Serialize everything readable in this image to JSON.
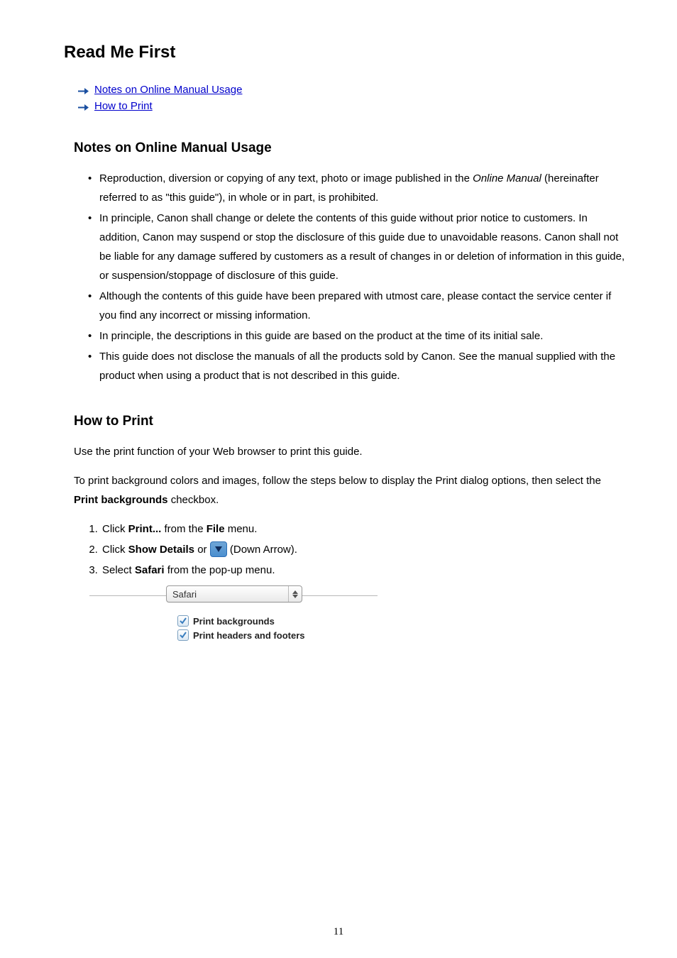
{
  "title": "Read Me First",
  "nav_links": [
    {
      "label": "Notes on Online Manual Usage"
    },
    {
      "label": "How to Print"
    }
  ],
  "section1": {
    "heading": "Notes on Online Manual Usage",
    "bullets": [
      {
        "pre": "Reproduction, diversion or copying of any text, photo or image published in the ",
        "em": "Online Manual",
        "post": " (hereinafter referred to as \"this guide\"), in whole or in part, is prohibited."
      },
      {
        "text": "In principle, Canon shall change or delete the contents of this guide without prior notice to customers. In addition, Canon may suspend or stop the disclosure of this guide due to unavoidable reasons. Canon shall not be liable for any damage suffered by customers as a result of changes in or deletion of information in this guide, or suspension/stoppage of disclosure of this guide."
      },
      {
        "text": "Although the contents of this guide have been prepared with utmost care, please contact the service center if you find any incorrect or missing information."
      },
      {
        "text": "In principle, the descriptions in this guide are based on the product at the time of its initial sale."
      },
      {
        "text": "This guide does not disclose the manuals of all the products sold by Canon. See the manual supplied with the product when using a product that is not described in this guide."
      }
    ]
  },
  "section2": {
    "heading": "How to Print",
    "para1": "Use the print function of your Web browser to print this guide.",
    "para2_pre": "To print background colors and images, follow the steps below to display the Print dialog options, then select the ",
    "para2_bold": "Print backgrounds",
    "para2_post": " checkbox.",
    "steps": {
      "s1_pre": "Click ",
      "s1_b1": "Print...",
      "s1_mid": " from the ",
      "s1_b2": "File",
      "s1_post": " menu.",
      "s2_pre": "Click ",
      "s2_b1": "Show Details",
      "s2_mid": " or ",
      "s2_post": " (Down Arrow).",
      "s3_pre": "Select ",
      "s3_b1": "Safari",
      "s3_post": " from the pop-up menu."
    }
  },
  "safari_panel": {
    "select_label": "Safari",
    "cb1": "Print backgrounds",
    "cb2": "Print headers and footers"
  },
  "page_number": "11"
}
